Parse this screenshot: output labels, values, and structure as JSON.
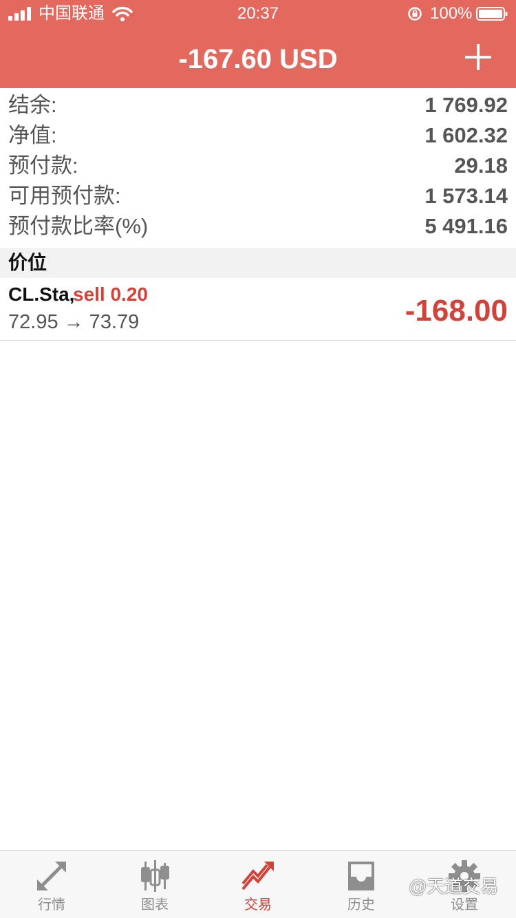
{
  "status_bar": {
    "carrier": "中国联通",
    "time": "20:37",
    "battery_percent": "100%"
  },
  "header": {
    "title": "-167.60 USD",
    "add_icon": "plus-icon",
    "background_color": "#e3695f"
  },
  "account": [
    {
      "label": "结余:",
      "value": "1 769.92"
    },
    {
      "label": "净值:",
      "value": "1 602.32"
    },
    {
      "label": "预付款:",
      "value": "29.18"
    },
    {
      "label": "可用预付款:",
      "value": "1 573.14"
    },
    {
      "label": "预付款比率(%)",
      "value": "5 491.16"
    }
  ],
  "positions": {
    "section_title": "价位",
    "items": [
      {
        "symbol": "CL.Sta,",
        "order": "sell 0.20",
        "prices": "72.95 → 73.79",
        "profit": "-168.00"
      }
    ]
  },
  "tabs": [
    {
      "label": "行情",
      "icon": "quotes-arrows-icon",
      "active": false
    },
    {
      "label": "图表",
      "icon": "candlestick-chart-icon",
      "active": false
    },
    {
      "label": "交易",
      "icon": "trade-trend-icon",
      "active": true
    },
    {
      "label": "历史",
      "icon": "history-tray-icon",
      "active": false
    },
    {
      "label": "设置",
      "icon": "gear-icon",
      "active": false
    }
  ],
  "watermark": "@天道交易",
  "colors": {
    "accent_red": "#d0423a",
    "inactive_gray": "#8e8e8e"
  }
}
